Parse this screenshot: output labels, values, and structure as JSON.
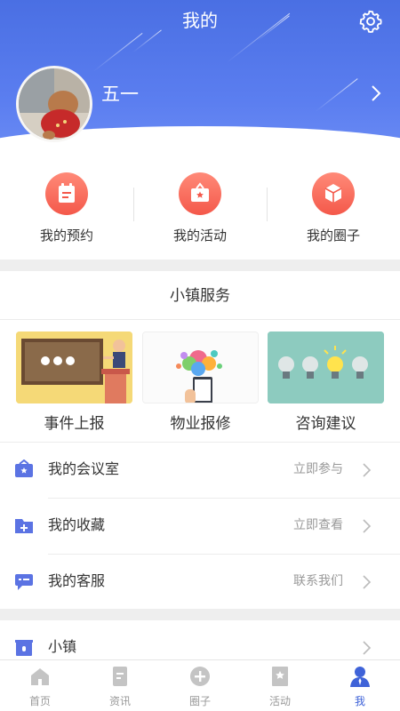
{
  "header": {
    "title": "我的",
    "username": "五一"
  },
  "quick_actions": [
    {
      "label": "我的预约",
      "icon": "calendar-icon"
    },
    {
      "label": "我的活动",
      "icon": "activity-icon"
    },
    {
      "label": "我的圈子",
      "icon": "cube-icon"
    }
  ],
  "services": {
    "title": "小镇服务",
    "items": [
      {
        "label": "事件上报",
        "icon": "report-illustration"
      },
      {
        "label": "物业报修",
        "icon": "repair-illustration"
      },
      {
        "label": "咨询建议",
        "icon": "lightbulb-illustration"
      }
    ]
  },
  "list": [
    {
      "label": "我的会议室",
      "value": "立即参与",
      "icon": "meeting-room-icon"
    },
    {
      "label": "我的收藏",
      "value": "立即查看",
      "icon": "favorites-folder-icon"
    },
    {
      "label": "我的客服",
      "value": "联系我们",
      "icon": "customer-service-icon"
    },
    {
      "label": "小镇",
      "value": "",
      "icon": "town-icon"
    }
  ],
  "tabs": [
    {
      "label": "首页",
      "icon": "home-icon",
      "active": false
    },
    {
      "label": "资讯",
      "icon": "news-icon",
      "active": false
    },
    {
      "label": "圈子",
      "icon": "circle-plus-icon",
      "active": false
    },
    {
      "label": "活动",
      "icon": "star-flag-icon",
      "active": false
    },
    {
      "label": "我",
      "icon": "user-icon",
      "active": true
    }
  ],
  "colors": {
    "header_blue": "#5577ea",
    "accent_red": "#f4584a",
    "tab_active": "#3f63d8",
    "list_icon": "#5b73e3"
  }
}
